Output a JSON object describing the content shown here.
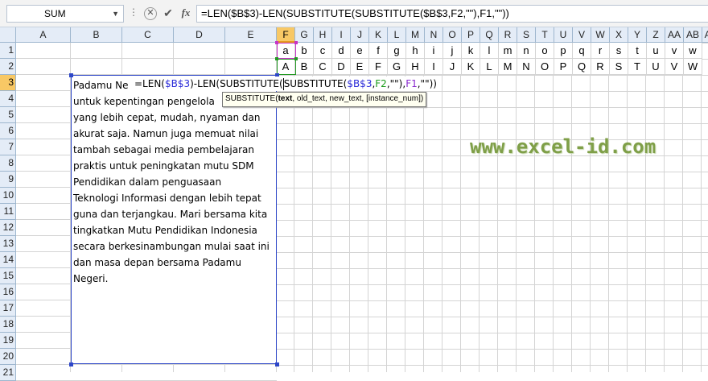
{
  "name_box": {
    "value": "SUM",
    "dropdown_icon": "chevron-down-icon"
  },
  "formula_bar": {
    "fx_label": "fx",
    "formula": "=LEN($B$3)-LEN(SUBSTITUTE(SUBSTITUTE($B$3,F2,\"\"),F1,\"\"))",
    "cancel_icon": "close-icon",
    "enter_icon": "check-icon"
  },
  "columns": [
    "A",
    "B",
    "C",
    "D",
    "E",
    "F",
    "G",
    "H",
    "I",
    "J",
    "K",
    "L",
    "M",
    "N",
    "O",
    "P",
    "Q",
    "R",
    "S",
    "T",
    "U",
    "V",
    "W",
    "X",
    "Y",
    "Z",
    "AA",
    "AB",
    "AC"
  ],
  "rows": [
    "1",
    "2",
    "3",
    "4",
    "5",
    "6",
    "7",
    "8",
    "9",
    "10",
    "11",
    "12",
    "13",
    "14",
    "15",
    "16",
    "17",
    "18",
    "19",
    "20",
    "21"
  ],
  "row1": [
    "a",
    "b",
    "c",
    "d",
    "e",
    "f",
    "g",
    "h",
    "i",
    "j",
    "k",
    "l",
    "m",
    "n",
    "o",
    "p",
    "q",
    "r",
    "s",
    "t",
    "u",
    "v",
    "w"
  ],
  "row2": [
    "A",
    "B",
    "C",
    "D",
    "E",
    "F",
    "G",
    "H",
    "I",
    "J",
    "K",
    "L",
    "M",
    "N",
    "O",
    "P",
    "Q",
    "R",
    "S",
    "T",
    "U",
    "V",
    "W"
  ],
  "cell_b3": {
    "first": "Padamu Ne",
    "lines": [
      "untuk kepentingan pengelola",
      "yang lebih cepat, mudah, nyaman dan",
      "akurat saja. Namun juga memuat nilai",
      "tambah sebagai media pembelajaran",
      "praktis untuk peningkatan mutu SDM",
      "Pendidikan dalam penguasaan",
      "Teknologi Informasi dengan lebih tepat",
      "guna dan terjangkau. Mari bersama kita",
      "tingkatkan Mutu Pendidikan Indonesia",
      "secara berkesinambungan mulai saat ini",
      "dan masa depan bersama Padamu",
      "Negeri."
    ]
  },
  "in_cell_formula": {
    "p1": "=LEN(",
    "ref1": "$B$3",
    "p2": ")-LEN(SUBSTITUTE(",
    "p3": "SUBSTITUTE(",
    "ref2": "$B$3",
    "p4": ",",
    "ref3": "F2",
    "p5": ",\"\"),",
    "ref4": "F1",
    "p6": ",\"\"))"
  },
  "tooltip": {
    "fn": "SUBSTITUTE(",
    "arg1": "text",
    "rest": ", old_text, new_text, [instance_num])"
  },
  "watermark": "www.excel-id.com",
  "colors": {
    "selected_header": "#f8c865",
    "header_bg": "#e4ecf7",
    "ref_blue": "#2a2ad8",
    "ref_green": "#1b9b1b",
    "ref_purple": "#8a2bcf",
    "watermark": "#7f9f48"
  }
}
